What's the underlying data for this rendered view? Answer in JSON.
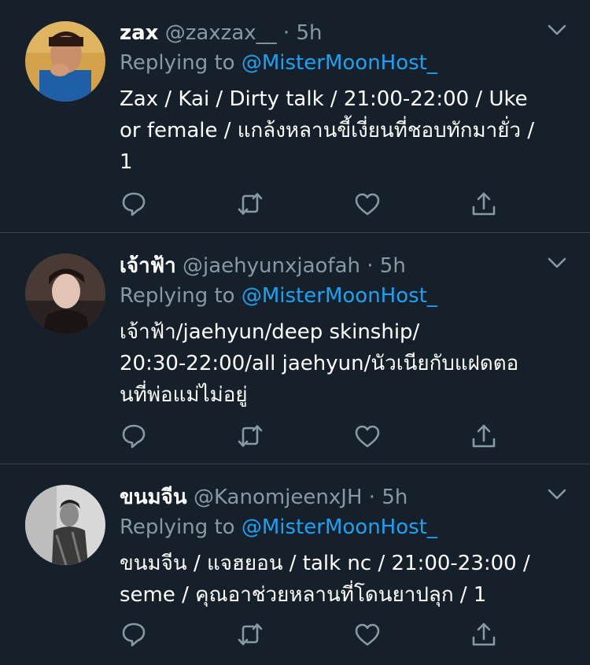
{
  "tweets": [
    {
      "name": "zax",
      "handle": "@zaxzax__",
      "separator": "·",
      "time": "5h",
      "replying_prefix": "Replying to",
      "replying_to": "@MisterMoonHost_",
      "lines": [
        "Zax / Kai / Dirty talk / 21:00-22:00 / Uke",
        "or female / แกล้งหลานขี้เงี่ยนที่ชอบทักมายั่ว /",
        "1"
      ]
    },
    {
      "name": "เจ้าฟ้า",
      "handle": "@jaehyunxjaofah",
      "separator": "·",
      "time": "5h",
      "replying_prefix": "Replying to",
      "replying_to": "@MisterMoonHost_",
      "lines": [
        "เจ้าฟ้า/jaehyun/deep skinship/",
        "20:30-22:00/all jaehyun/นัวเนียกับแฝดตอ",
        "นที่พ่อแม่ไม่อยู่"
      ]
    },
    {
      "name": "ขนมจีน",
      "handle": "@KanomjeenxJH",
      "separator": "·",
      "time": "5h",
      "replying_prefix": "Replying to",
      "replying_to": "@MisterMoonHost_",
      "lines": [
        "ขนมจีน / แจฮยอน / talk nc / 21:00-23:00 /",
        "seme / คุณอาช่วยหลานที่โดนยาปลุก / 1"
      ]
    }
  ],
  "icons": {
    "reply": "reply-icon",
    "retweet": "retweet-icon",
    "like": "heart-icon",
    "share": "share-icon",
    "more": "chevron-down-icon"
  },
  "colors": {
    "background": "#15202b",
    "divider": "#38444d",
    "secondary_text": "#8899a6",
    "accent": "#1da1f2"
  }
}
